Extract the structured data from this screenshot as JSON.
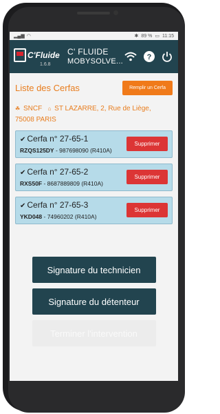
{
  "statusbar": {
    "battery": "89 %",
    "time": "11:15"
  },
  "app": {
    "logo_text": "C'Fluide",
    "version": "1.6.8",
    "title": "C' FLUIDE",
    "subtitle": "MOBYSOLVE..."
  },
  "page": {
    "title": "Liste des Cerfas",
    "action_label": "Remplir un Cerfa"
  },
  "org": {
    "company": "SNCF",
    "address_line1": "ST LAZARRE, 2, Rue de Liège,",
    "address_line2": "75008 PARIS"
  },
  "cerfas": [
    {
      "title": "Cerfa n° 27-65-1",
      "code": "RZQS125DY",
      "details": " - 987698090 (R410A)",
      "delete_label": "Supprimer"
    },
    {
      "title": "Cerfa n° 27-65-2",
      "code": "RXS50F",
      "details": " - 8687889809 (R410A)",
      "delete_label": "Supprimer"
    },
    {
      "title": "Cerfa n° 27-65-3",
      "code": "YKD048",
      "details": " - 74960202 (R410A)",
      "delete_label": "Supprimer"
    }
  ],
  "actions": {
    "sign_tech": "Signature du technicien",
    "sign_holder": "Signature du détenteur",
    "finish": "Terminer l'intervention"
  },
  "colors": {
    "appbar": "#22444f",
    "accent": "#f07a1a",
    "danger": "#dc3535",
    "card": "#b6dbe9"
  }
}
